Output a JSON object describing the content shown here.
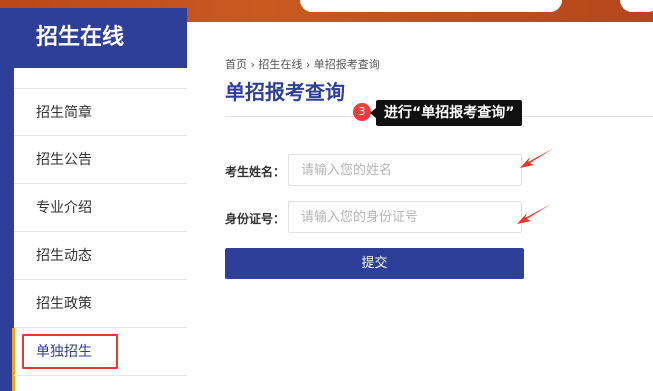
{
  "sidebar": {
    "title": "招生在线",
    "items": [
      {
        "label": "招生简章"
      },
      {
        "label": "招生公告"
      },
      {
        "label": "专业介绍"
      },
      {
        "label": "招生动态"
      },
      {
        "label": "招生政策"
      },
      {
        "label": "单独招生",
        "active": true
      }
    ]
  },
  "breadcrumb": "首页 › 招生在线 › 单招报考查询",
  "page_title": "单招报考查询",
  "tooltip": {
    "step": "3",
    "text": "进行“单招报考查询”"
  },
  "form": {
    "name_label": "考生姓名：",
    "name_placeholder": "请输入您的姓名",
    "id_label": "身份证号：",
    "id_placeholder": "请输入您的身份证号",
    "submit_label": "提交"
  },
  "colors": {
    "brand": "#2e3f9a",
    "banner": "#b8481a",
    "highlight": "#e53935",
    "accent": "#f3a31c"
  }
}
